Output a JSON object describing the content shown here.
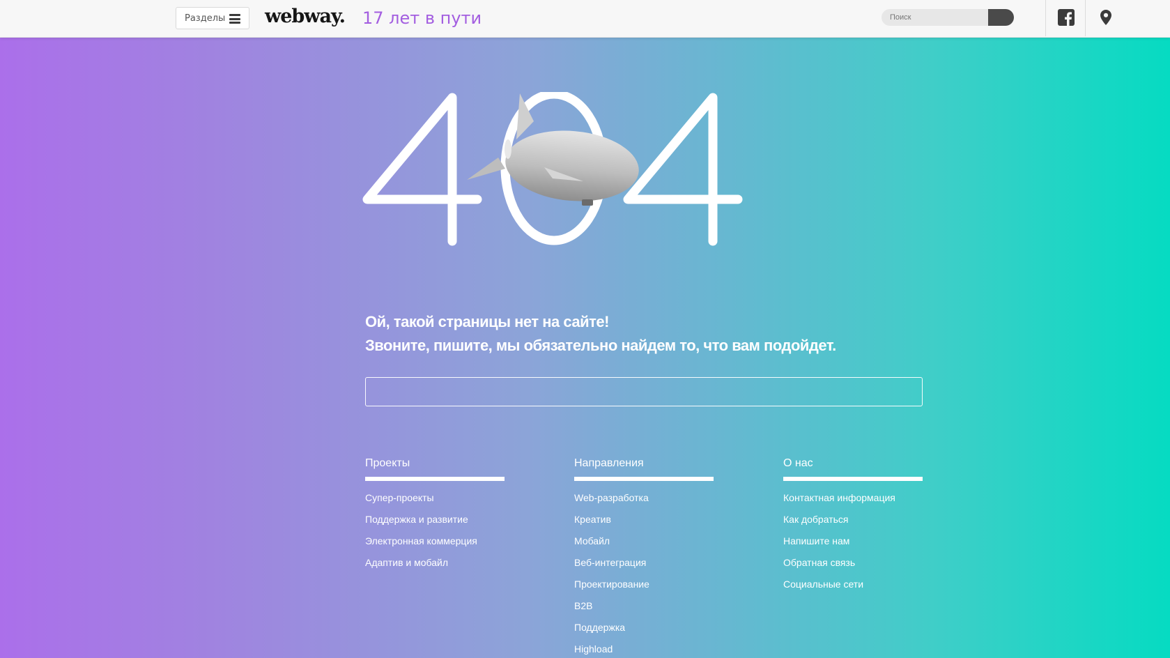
{
  "header": {
    "menu_label": "Разделы",
    "logo": "webway.",
    "tagline": "17 лет в пути",
    "search_placeholder": "Поиск",
    "icons": [
      "menu-icon",
      "facebook-icon",
      "map-pin-icon",
      "search-icon"
    ]
  },
  "error": {
    "code": "404",
    "message_line1": "Ой, такой страницы нет на сайте!",
    "message_line2": "Звоните, пишите, мы обязательно найдем то, что вам подойдет.",
    "search_value": ""
  },
  "footer": {
    "columns": [
      {
        "title": "Проекты",
        "links": [
          "Супер-проекты",
          "Поддержка и развитие",
          "Электронная коммерция",
          "Адаптив и мобайл"
        ]
      },
      {
        "title": "Направления",
        "links": [
          "Web-разработка",
          "Креатив",
          "Мобайл",
          "Веб-интеграция",
          "Проектирование",
          "B2B",
          "Поддержка",
          "Highload"
        ]
      },
      {
        "title": "О нас",
        "links": [
          "Контактная информация",
          "Как добраться",
          "Напишите нам",
          "Обратная связь",
          "Социальные сети"
        ]
      }
    ]
  },
  "colors": {
    "gradient_left": "#ab6fea",
    "gradient_right": "#06dbc2",
    "tagline": "#a35ee0"
  }
}
